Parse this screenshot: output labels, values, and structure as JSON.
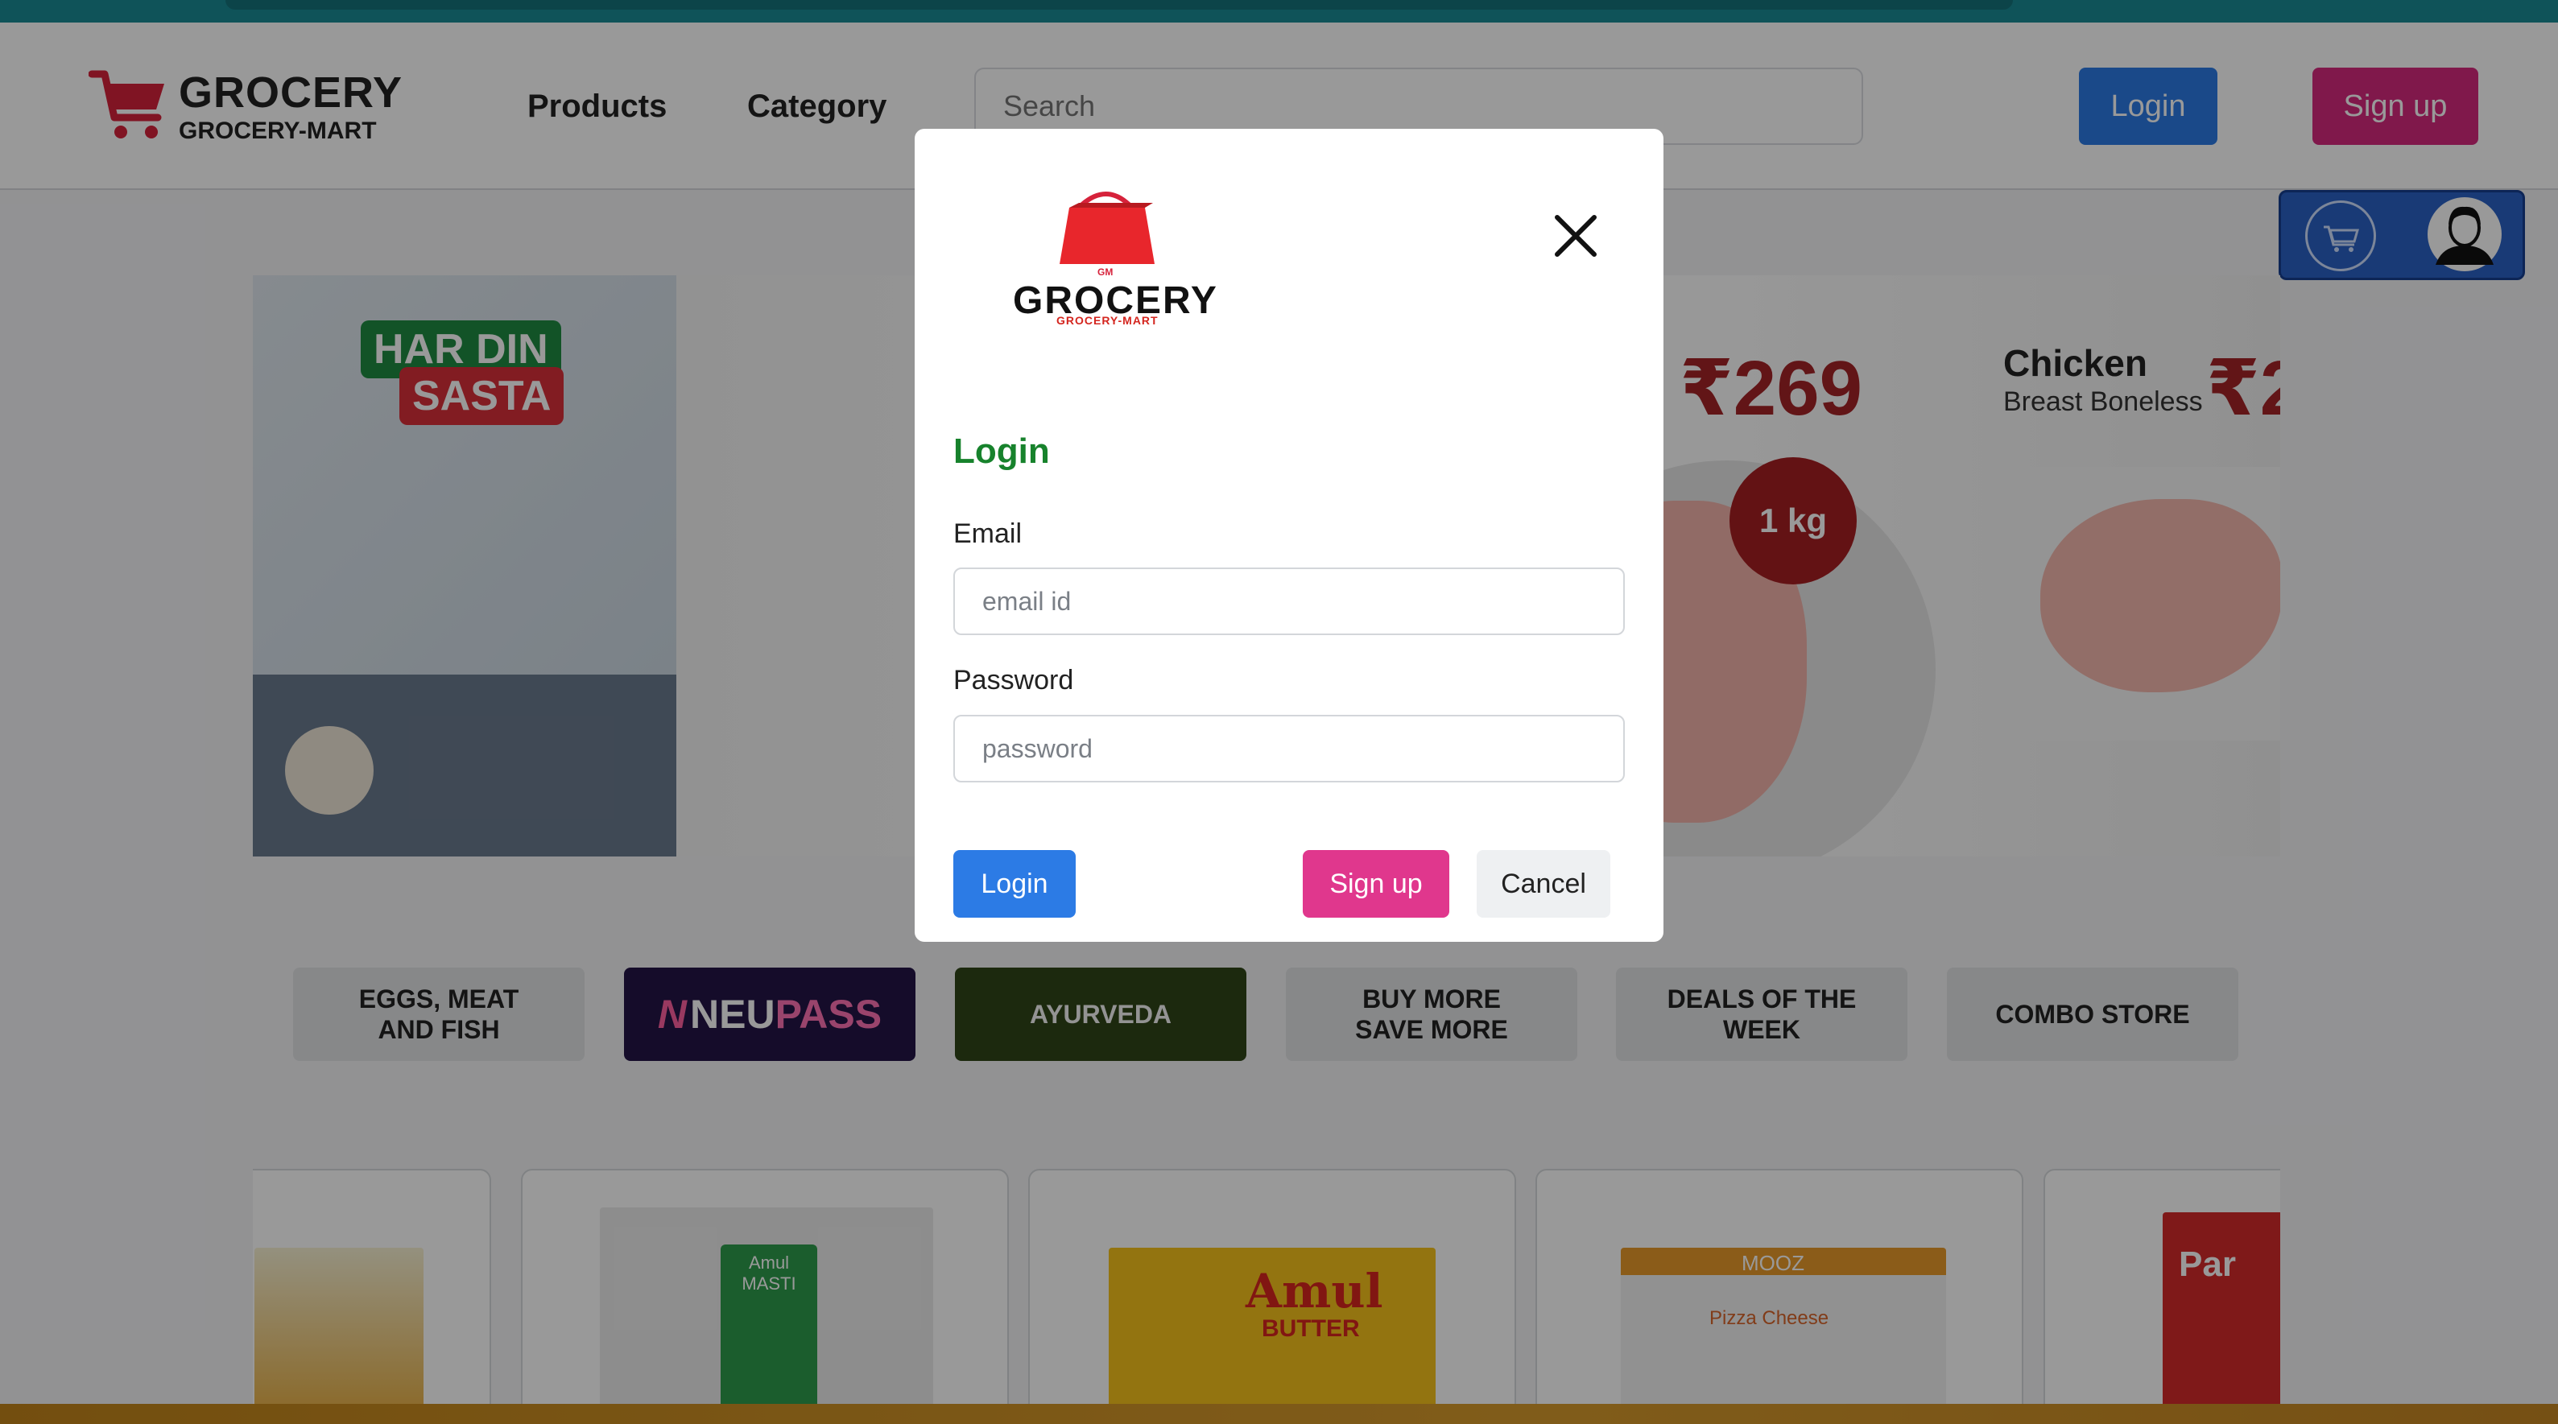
{
  "header": {
    "brand_title": "GROCERY",
    "brand_subtitle": "GROCERY-MART",
    "nav": [
      "Products",
      "Category"
    ],
    "search_placeholder": "Search",
    "login_label": "Login",
    "signup_label": "Sign up"
  },
  "banner": {
    "tag_line1": "HAR DIN",
    "tag_line2": "SASTA",
    "price_1": "₹269",
    "weight_badge": "1 kg",
    "product_title": "Chicken",
    "product_subtitle": "Breast Boneless",
    "price_2": "₹2"
  },
  "categories": {
    "eggs": "EGGS, MEAT AND FISH",
    "neupass_n": "N",
    "neupass_neu": "NEU",
    "neupass_pass": "PASS",
    "ayurveda": "AYURVEDA",
    "buy_more": "BUY MORE SAVE MORE",
    "deals": "DEALS OF THE WEEK",
    "combo": "COMBO STORE"
  },
  "modal": {
    "logo_small": "GM",
    "logo_title": "GROCERY",
    "logo_sub": "GROCERY-MART",
    "heading": "Login",
    "email_label": "Email",
    "email_placeholder": "email id",
    "password_label": "Password",
    "password_placeholder": "password",
    "login_label": "Login",
    "signup_label": "Sign up",
    "cancel_label": "Cancel"
  },
  "products": {
    "amul_masti": "Amul MASTI",
    "amul_butter": "Amul",
    "amul_butter_sub": "BUTTER",
    "mooz": "MOOZ",
    "mooz_sub": "Pizza Cheese",
    "cut_off": "Par"
  },
  "colors": {
    "primary_blue": "#2c7be5",
    "signup_pink": "#d6287e",
    "heading_green": "#17822c",
    "banner_price_red": "#a42427"
  },
  "icons": [
    "cart-icon",
    "close-icon",
    "shopping-bag-icon",
    "user-avatar-icon"
  ]
}
